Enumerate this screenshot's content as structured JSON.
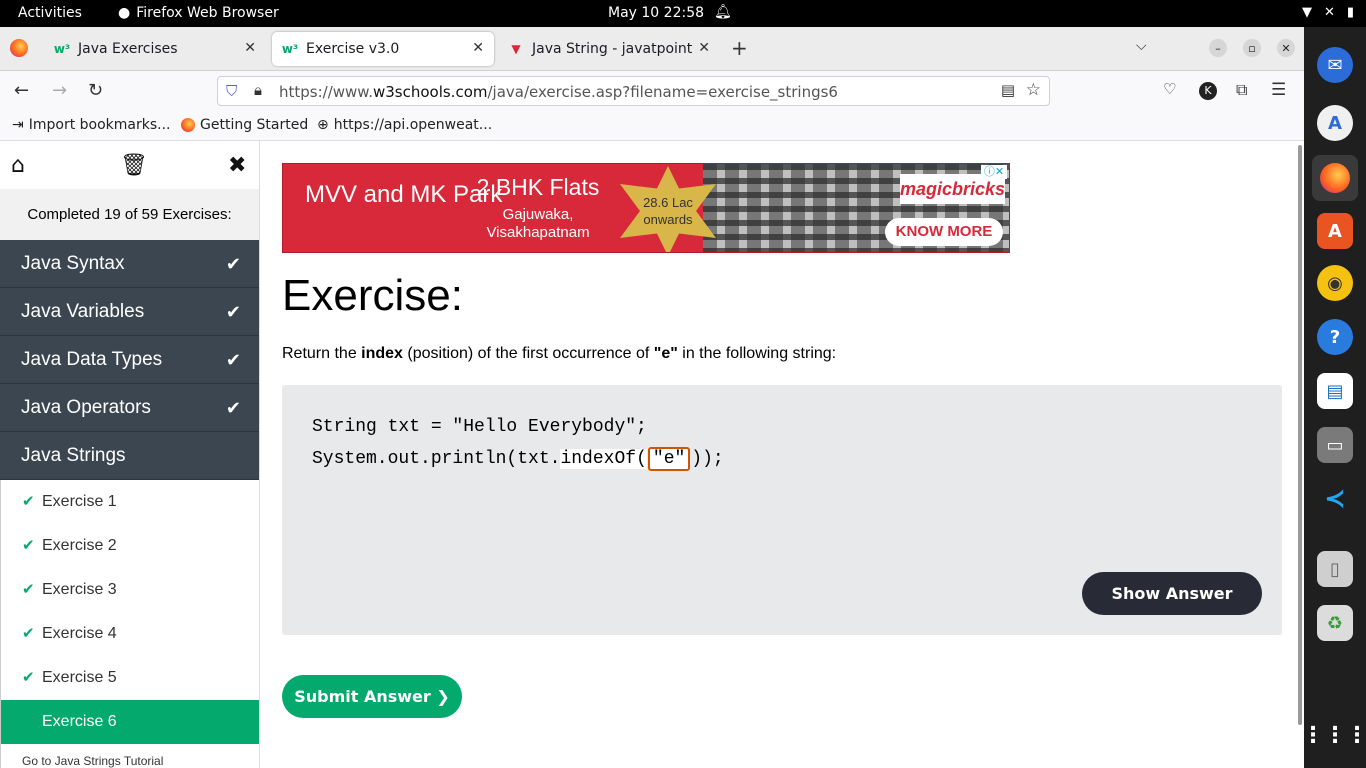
{
  "topbar": {
    "activities": "Activities",
    "app_name": "Firefox Web Browser",
    "clock": "May 10  22:58"
  },
  "tabs": [
    {
      "label": "Java Exercises",
      "icon": "w3schools-favicon"
    },
    {
      "label": "Exercise v3.0",
      "icon": "w3schools-favicon",
      "active": true
    },
    {
      "label": "Java String - javatpoint",
      "icon": "javatpoint-favicon"
    }
  ],
  "navbar": {
    "url_prefix": "https://www.",
    "url_host": "w3schools.com",
    "url_path": "/java/exercise.asp?filename=exercise_strings6"
  },
  "bookmarks": [
    {
      "label": "Import bookmarks..."
    },
    {
      "label": "Getting Started"
    },
    {
      "label": "https://api.openweat..."
    }
  ],
  "sidebar": {
    "completed": "Completed 19 of 59 Exercises:",
    "categories": [
      {
        "label": "Java Syntax",
        "done": true
      },
      {
        "label": "Java Variables",
        "done": true
      },
      {
        "label": "Java Data Types",
        "done": true
      },
      {
        "label": "Java Operators",
        "done": true
      },
      {
        "label": "Java Strings",
        "done": false
      }
    ],
    "exercises": [
      {
        "label": "Exercise 1",
        "done": true
      },
      {
        "label": "Exercise 2",
        "done": true
      },
      {
        "label": "Exercise 3",
        "done": true
      },
      {
        "label": "Exercise 4",
        "done": true
      },
      {
        "label": "Exercise 5",
        "done": true
      },
      {
        "label": "Exercise 6",
        "active": true
      }
    ],
    "goto": "Go to Java Strings Tutorial"
  },
  "ad": {
    "headline": "MVV and MK Park",
    "offer": "2 BHK Flats",
    "location": "Gajuwaka, Visakhapatnam",
    "price_line1": "28.6 Lac",
    "price_line2": "onwards",
    "brand": "magicbricks",
    "cta": "KNOW MORE"
  },
  "exercise": {
    "title": "Exercise:",
    "desc_pre": "Return the ",
    "desc_bold1": "index",
    "desc_mid": " (position) of the first occurrence of ",
    "desc_bold2": "\"e\"",
    "desc_post": " in the following string:",
    "code_line1": "String txt = \"Hello Everybody\";",
    "code_line2_pre": "System.out.println(txt.",
    "code_line2_method": "indexOf",
    "code_line2_paren": "(",
    "answer_value": "\"e\"",
    "code_line2_post": "));",
    "show_answer": "Show Answer",
    "submit": "Submit Answer ❯"
  },
  "colors": {
    "accent_green": "#04aa6d",
    "sidebar_dark": "#3b4650",
    "button_dark": "#282a35",
    "ad_red": "#d8293a",
    "answer_border": "#d35400"
  }
}
